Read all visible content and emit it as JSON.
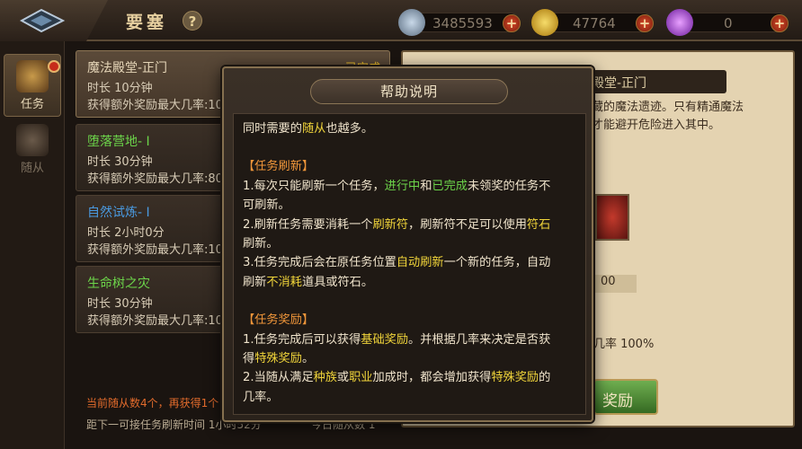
{
  "header": {
    "title": "要塞",
    "help_label": "?",
    "resources": [
      {
        "name": "silver",
        "value": "3485593",
        "color": "#8aa0c0"
      },
      {
        "name": "gold",
        "value": "47764",
        "color": "#d6a81c"
      },
      {
        "name": "gem",
        "value": "0",
        "color": "#9c48c8"
      }
    ],
    "plus_label": "+"
  },
  "sidebar": {
    "tabs": [
      {
        "label": "任务",
        "active": true
      },
      {
        "label": "随从",
        "active": false
      }
    ]
  },
  "tasks": [
    {
      "name": "魔法殿堂-正门",
      "duration": "时长 10分钟",
      "bonus": "获得额外奖励最大几率:10",
      "status": "已完成",
      "name_color": "#e8d9b8",
      "selected": true
    },
    {
      "name": "堕落营地- I",
      "duration": "时长 30分钟",
      "bonus": "获得额外奖励最大几率:80",
      "name_color": "#6cd44a"
    },
    {
      "name": "自然试炼- I",
      "duration": "时长 2小时0分",
      "bonus": "获得额外奖励最大几率:10",
      "name_color": "#4a9ae0"
    },
    {
      "name": "生命树之灾",
      "duration": "时长 30分钟",
      "bonus": "获得额外奖励最大几率:10",
      "name_color": "#6cd44a"
    }
  ],
  "footer": {
    "followers_info": "当前随从数4个，再获得1个",
    "refresh_info": "距下一可接任务刷新时间 1小时52分",
    "today_info": "今日随从数 1"
  },
  "detail": {
    "title": "殿堂-正门",
    "desc_line1": "藏的魔法遗迹。只有精通魔法",
    "desc_line2": "才能避开危险进入其中。",
    "field_value": "00",
    "rate": "几率 100%",
    "reward_label": "奖励"
  },
  "dialog": {
    "title": "帮助说明",
    "intro": [
      "同时需要的",
      "随从",
      "也越多。"
    ],
    "section1_title": "【任务刷新】",
    "s1_l1": [
      "1.每次只能刷新一个任务，",
      "进行中",
      "和",
      "已完成",
      "未领奖的任务不"
    ],
    "s1_l2": "可刷新。",
    "s1_l3": [
      "2.刷新任务需要消耗一个",
      "刷新符",
      "，刷新符不足可以使用",
      "符石"
    ],
    "s1_l4": "刷新。",
    "s1_l5": [
      "3.任务完成后会在原任务位置",
      "自动刷新",
      "一个新的任务，自动"
    ],
    "s1_l6": [
      "刷新",
      "不消耗",
      "道具或符石。"
    ],
    "section2_title": "【任务奖励】",
    "s2_l1": [
      "1.任务完成后可以获得",
      "基础奖励",
      "。并根据几率来决定是否获"
    ],
    "s2_l2": [
      "得",
      "特殊奖励",
      "。"
    ],
    "s2_l3": [
      "2.当随从满足",
      "种族",
      "或",
      "职业",
      "加成时，都会增加获得",
      "特殊奖励",
      "的"
    ],
    "s2_l4": "几率。"
  }
}
